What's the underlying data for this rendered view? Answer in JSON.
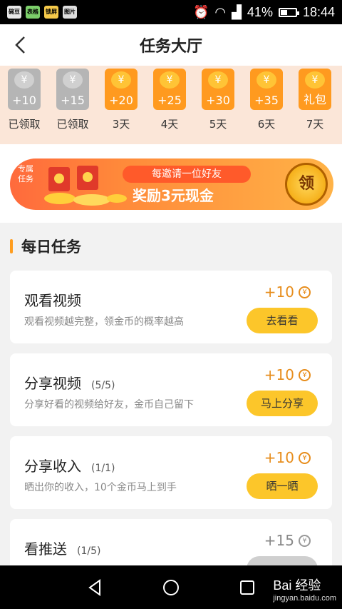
{
  "status_bar": {
    "app_icons": [
      "碗豆",
      "表格",
      "锁屏",
      "图片"
    ],
    "battery_percent": "41%",
    "time": "18:44"
  },
  "header": {
    "title": "任务大厅"
  },
  "checkin": [
    {
      "value": "+10",
      "label": "已领取",
      "state": "claimed"
    },
    {
      "value": "+15",
      "label": "已领取",
      "state": "claimed"
    },
    {
      "value": "+20",
      "label": "3天",
      "state": "pending"
    },
    {
      "value": "+25",
      "label": "4天",
      "state": "pending"
    },
    {
      "value": "+30",
      "label": "5天",
      "state": "pending"
    },
    {
      "value": "+35",
      "label": "6天",
      "state": "pending"
    },
    {
      "value": "礼包",
      "label": "7天",
      "state": "pending"
    }
  ],
  "coin_symbol": "¥",
  "banner": {
    "tag": "专属任务",
    "line1": "每邀请一位好友",
    "line2": "奖励3元现金",
    "button": "领"
  },
  "section": {
    "title": "每日任务"
  },
  "tasks": [
    {
      "title": "观看视频",
      "progress": "",
      "desc": "观看视频越完整，领金币的概率越高",
      "reward": "+10",
      "button": "去看看",
      "enabled": true
    },
    {
      "title": "分享视频",
      "progress": "(5/5)",
      "desc": "分享好看的视频给好友，金币自己留下",
      "reward": "+10",
      "button": "马上分享",
      "enabled": true
    },
    {
      "title": "分享收入",
      "progress": "(1/1)",
      "desc": "晒出你的收入，10个金币马上到手",
      "reward": "+10",
      "button": "晒一晒",
      "enabled": true
    },
    {
      "title": "看推送",
      "progress": "(1/5)",
      "desc": "",
      "reward": "+15",
      "button": "",
      "enabled": false
    }
  ],
  "watermark": {
    "main": "Bai  经验",
    "sub": "jingyan.baidu.com"
  },
  "colors": {
    "accent": "#ff9d1f",
    "button_yellow": "#fcc62a",
    "reward_orange": "#e78d1c",
    "checkin_bg": "#fbe6d8"
  }
}
